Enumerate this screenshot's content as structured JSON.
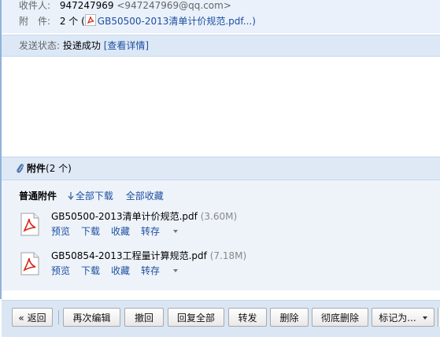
{
  "header": {
    "recipient_label": "收件人:",
    "recipient_name": "947247969",
    "recipient_email": "<947247969@qq.com>",
    "attach_label": "附　件:",
    "attach_summary_prefix": "2 个 (",
    "attach_summary_link": "GB50500-2013清单计价规范.pdf...)"
  },
  "status": {
    "label": "发送状态:",
    "value": "投递成功",
    "details_link": "[查看详情]"
  },
  "attachments": {
    "title": "附件",
    "count": "(2 个)",
    "section_title": "普通附件",
    "download_all": "全部下载",
    "save_all": "全部收藏",
    "files": [
      {
        "name": "GB50500-2013清单计价规范.pdf",
        "size": "(3.60M)",
        "icon": "pdf-icon"
      },
      {
        "name": "GB50854-2013工程量计算规范.pdf",
        "size": "(7.18M)",
        "icon": "pdf-icon"
      }
    ],
    "actions": {
      "preview": "预览",
      "download": "下载",
      "save": "收藏",
      "transfer": "转存"
    }
  },
  "toolbar": {
    "back": "« 返回",
    "edit_again": "再次编辑",
    "recall": "撤回",
    "reply_all": "回复全部",
    "forward": "转发",
    "delete": "删除",
    "delete_permanently": "彻底删除",
    "mark_as": "标记为..."
  },
  "colors": {
    "link": "#1d4fa0",
    "header_bg": "#eaf1fb",
    "toolbar_bg": "#dbe6f4"
  }
}
